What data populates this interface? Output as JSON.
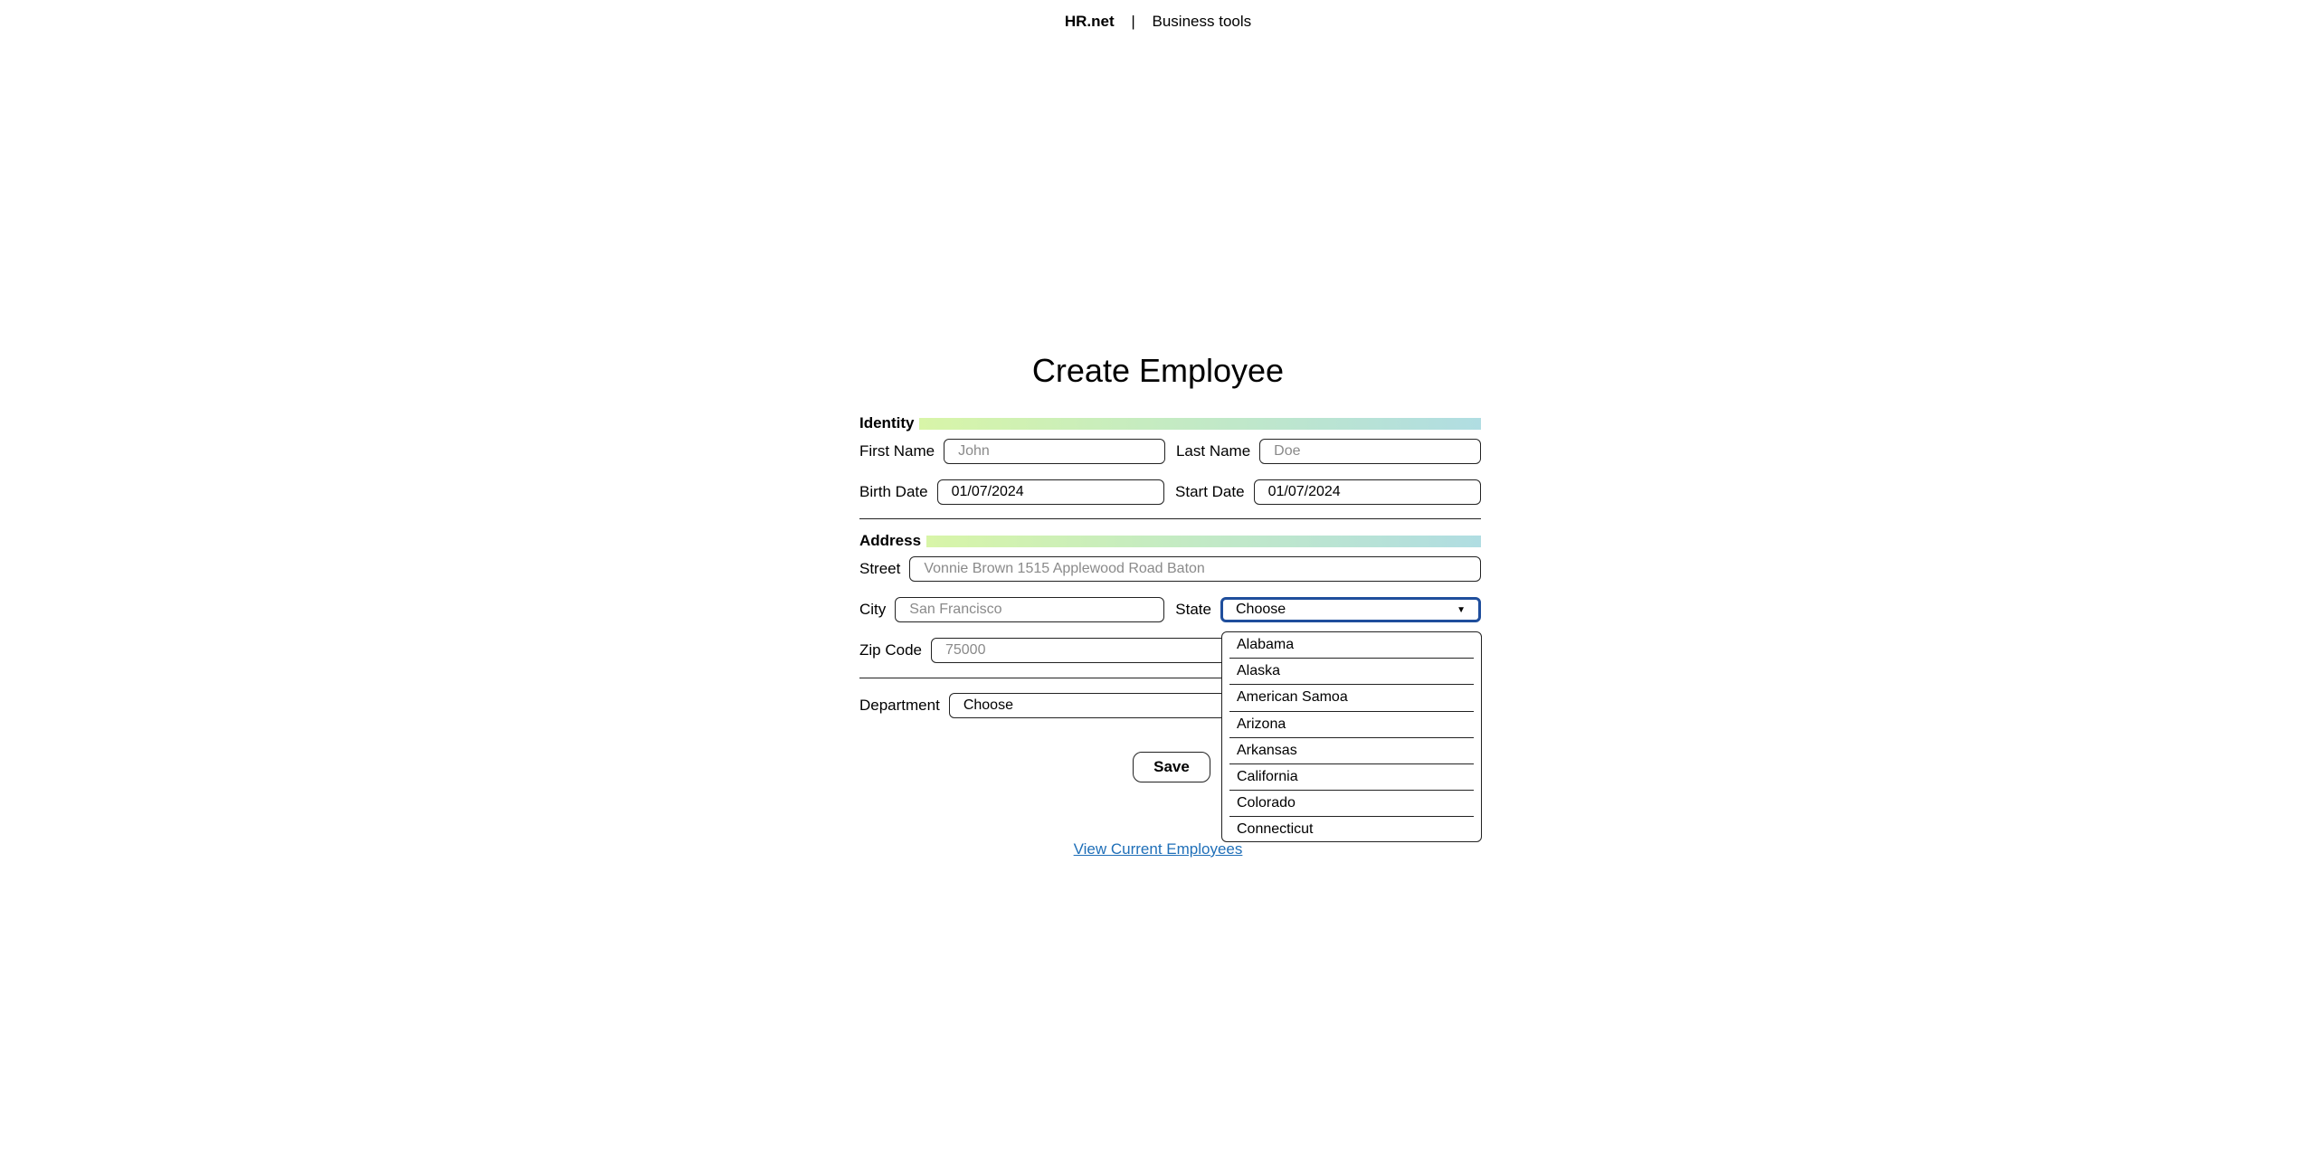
{
  "header": {
    "brand": "HR.net",
    "separator": "|",
    "tagline": "Business tools"
  },
  "page_title": "Create Employee",
  "identity": {
    "section_label": "Identity",
    "first_name_label": "First Name",
    "first_name_placeholder": "John",
    "last_name_label": "Last Name",
    "last_name_placeholder": "Doe",
    "birth_date_label": "Birth Date",
    "birth_date_value": "01/07/2024",
    "start_date_label": "Start Date",
    "start_date_value": "01/07/2024"
  },
  "address": {
    "section_label": "Address",
    "street_label": "Street",
    "street_placeholder": "Vonnie Brown 1515 Applewood Road Baton",
    "city_label": "City",
    "city_placeholder": "San Francisco",
    "state_label": "State",
    "state_value": "Choose",
    "zip_label": "Zip Code",
    "zip_placeholder": "75000"
  },
  "department": {
    "label": "Department",
    "value": "Choose"
  },
  "state_dropdown": {
    "options": [
      "Alabama",
      "Alaska",
      "American Samoa",
      "Arizona",
      "Arkansas",
      "California",
      "Colorado",
      "Connecticut"
    ]
  },
  "actions": {
    "save_label": "Save",
    "view_employees_label": "View Current Employees"
  },
  "icons": {
    "select_arrow": "caret-down-icon"
  }
}
